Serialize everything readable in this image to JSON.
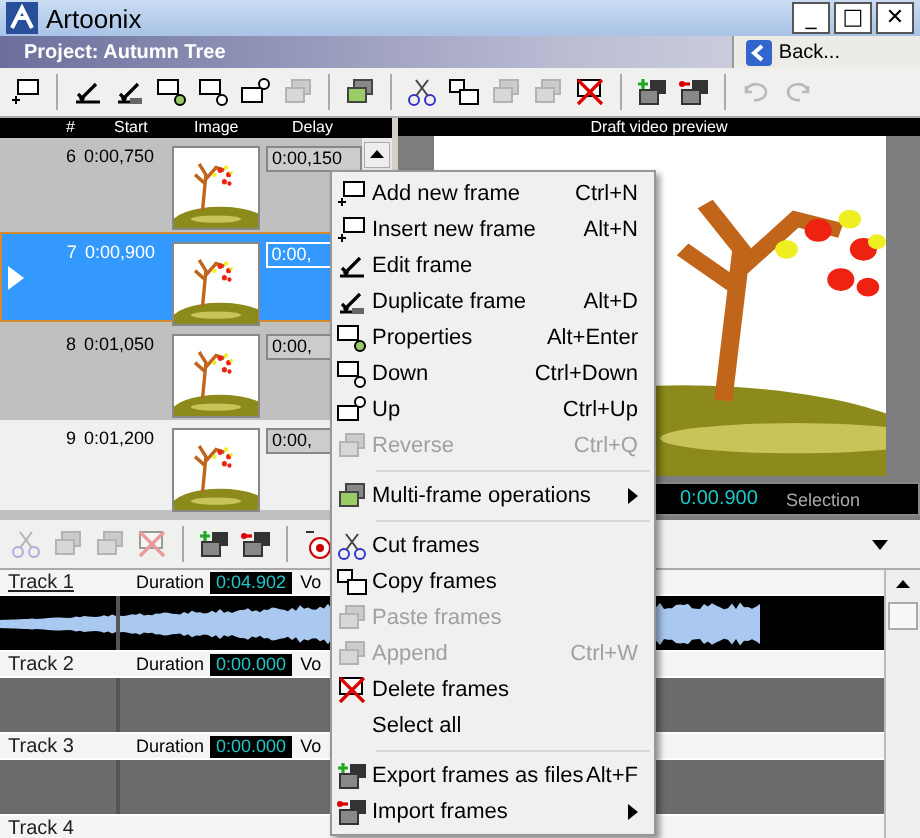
{
  "window": {
    "title": "Artoonix",
    "controls": [
      "_",
      "□",
      "✕"
    ]
  },
  "project_bar": {
    "title": "Project: Autumn Tree",
    "back_button": "Back..."
  },
  "toolbar": [
    {
      "kind": "button",
      "disabled": false
    },
    {
      "kind": "separator"
    },
    {
      "kind": "button",
      "disabled": false
    },
    {
      "kind": "button",
      "disabled": false
    },
    {
      "kind": "button",
      "disabled": false
    },
    {
      "kind": "button",
      "disabled": false
    },
    {
      "kind": "button",
      "disabled": false
    },
    {
      "kind": "button",
      "disabled": true
    },
    {
      "kind": "separator"
    },
    {
      "kind": "button",
      "disabled": false
    },
    {
      "kind": "separator"
    },
    {
      "kind": "button",
      "disabled": false
    },
    {
      "kind": "button",
      "disabled": false
    },
    {
      "kind": "button",
      "disabled": true
    },
    {
      "kind": "button",
      "disabled": true
    },
    {
      "kind": "button",
      "disabled": false
    },
    {
      "kind": "separator"
    },
    {
      "kind": "button",
      "disabled": false
    },
    {
      "kind": "button",
      "disabled": false
    },
    {
      "kind": "separator"
    },
    {
      "kind": "button",
      "disabled": true
    },
    {
      "kind": "button",
      "disabled": true
    }
  ],
  "frame_list": {
    "columns": [
      "#",
      "Start",
      "Image",
      "Delay"
    ],
    "rows": [
      {
        "number": "6",
        "start": "0:00,750",
        "delay": "0:00,150",
        "selected": false
      },
      {
        "number": "7",
        "start": "0:00,900",
        "delay": "0:00,",
        "selected": true
      },
      {
        "number": "8",
        "start": "0:01,050",
        "delay": "0:00,",
        "selected": false
      },
      {
        "number": "9",
        "start": "0:01,200",
        "delay": "0:00,",
        "selected": false
      }
    ]
  },
  "preview": {
    "title": "Draft video preview",
    "time": "0:00.900",
    "selection_label": "Selection"
  },
  "audio_toolbar": [
    {
      "kind": "button",
      "disabled": true
    },
    {
      "kind": "button",
      "disabled": true
    },
    {
      "kind": "button",
      "disabled": true
    },
    {
      "kind": "button",
      "disabled": true
    },
    {
      "kind": "separator"
    },
    {
      "kind": "button",
      "disabled": false
    },
    {
      "kind": "button",
      "disabled": false
    },
    {
      "kind": "separator"
    },
    {
      "kind": "button",
      "disabled": false
    }
  ],
  "tracks": [
    {
      "name": "Track 1",
      "selected": true,
      "duration_label": "Duration",
      "duration": "0:04.902",
      "volume_label": "Vo",
      "has_audio": true
    },
    {
      "name": "Track 2",
      "selected": false,
      "duration_label": "Duration",
      "duration": "0:00.000",
      "volume_label": "Vo",
      "has_audio": false
    },
    {
      "name": "Track 3",
      "selected": false,
      "duration_label": "Duration",
      "duration": "0:00.000",
      "volume_label": "Vo",
      "has_audio": false
    },
    {
      "name": "Track 4"
    }
  ],
  "context_menu": [
    {
      "kind": "item",
      "label": "Add new frame",
      "shortcut": "Ctrl+N",
      "disabled": false
    },
    {
      "kind": "item",
      "label": "Insert new frame",
      "shortcut": "Alt+N",
      "disabled": false
    },
    {
      "kind": "item",
      "label": "Edit frame",
      "disabled": false
    },
    {
      "kind": "item",
      "label": "Duplicate frame",
      "shortcut": "Alt+D",
      "disabled": false
    },
    {
      "kind": "item",
      "label": "Properties",
      "shortcut": "Alt+Enter",
      "disabled": false
    },
    {
      "kind": "item",
      "label": "Down",
      "shortcut": "Ctrl+Down",
      "disabled": false
    },
    {
      "kind": "item",
      "label": "Up",
      "shortcut": "Ctrl+Up",
      "disabled": false
    },
    {
      "kind": "item",
      "label": "Reverse",
      "shortcut": "Ctrl+Q",
      "disabled": true
    },
    {
      "kind": "separator"
    },
    {
      "kind": "submenu",
      "label": "Multi-frame operations",
      "disabled": false
    },
    {
      "kind": "separator"
    },
    {
      "kind": "item",
      "label": "Cut frames",
      "disabled": false
    },
    {
      "kind": "item",
      "label": "Copy frames",
      "disabled": false
    },
    {
      "kind": "item",
      "label": "Paste frames",
      "disabled": true
    },
    {
      "kind": "item",
      "label": "Append",
      "shortcut": "Ctrl+W",
      "disabled": true
    },
    {
      "kind": "item",
      "label": "Delete frames",
      "disabled": false
    },
    {
      "kind": "item",
      "label": "Select all",
      "disabled": false
    },
    {
      "kind": "separator"
    },
    {
      "kind": "item",
      "label": "Export frames as files",
      "shortcut": "Alt+F",
      "disabled": false
    },
    {
      "kind": "submenu",
      "label": "Import frames",
      "disabled": false
    }
  ]
}
